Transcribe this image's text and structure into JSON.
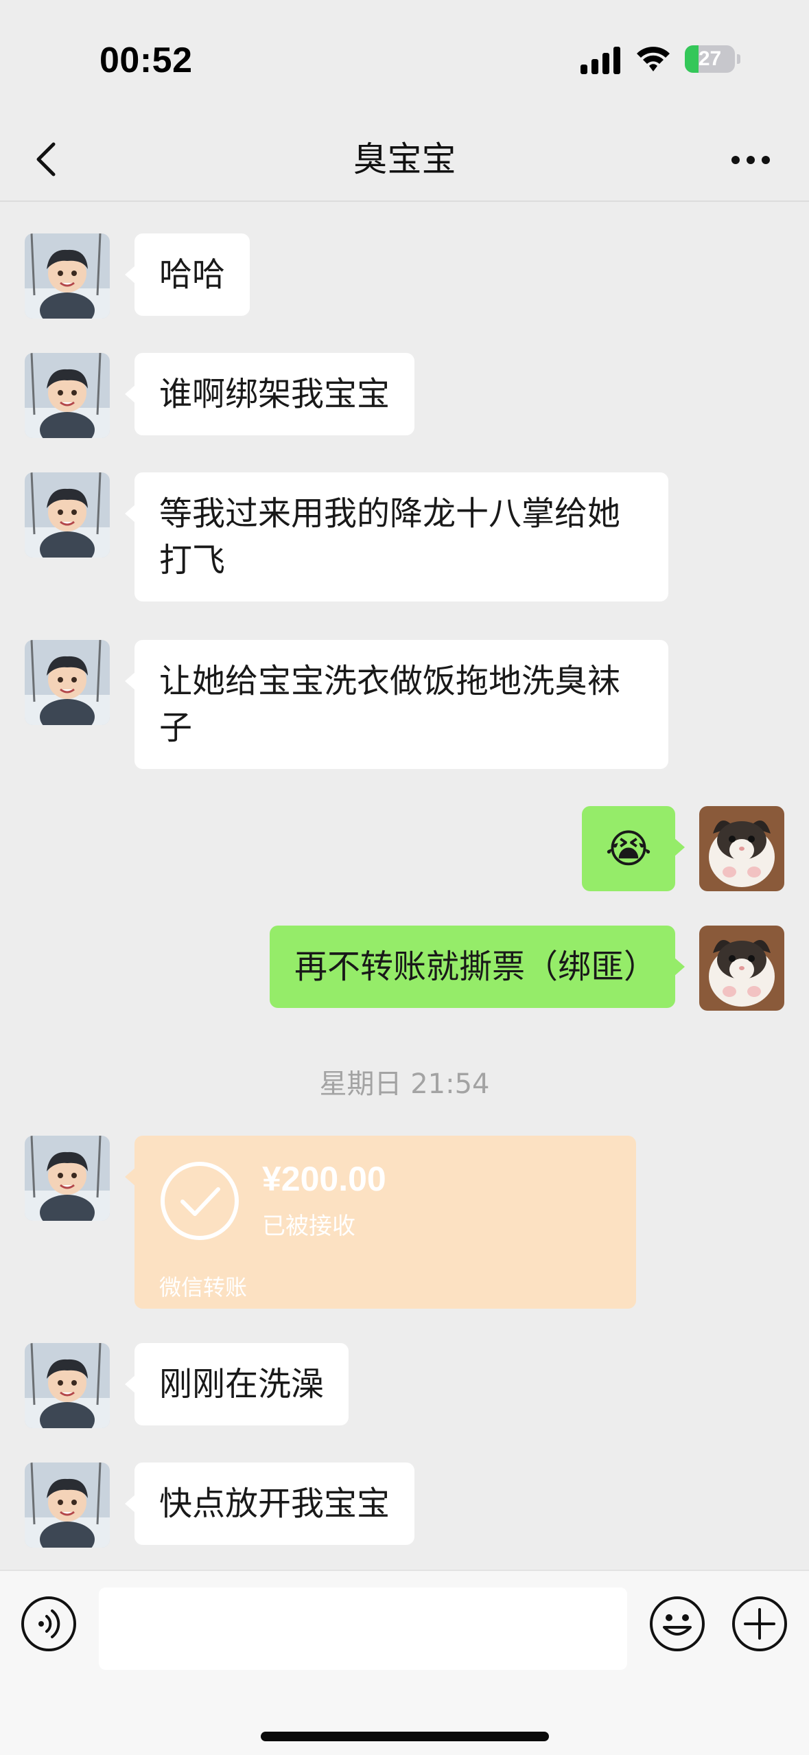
{
  "status_bar": {
    "time": "00:52",
    "battery_level": "27",
    "battery_fraction": 0.27,
    "battery_color": "#34c759",
    "icons": [
      "cellular-signal-icon",
      "wifi-icon",
      "battery-charging-icon"
    ]
  },
  "nav": {
    "title": "臭宝宝",
    "back_icon": "chevron-left-icon",
    "more_icon": "ellipsis-icon"
  },
  "messages": [
    {
      "side": "in",
      "type": "text",
      "text": "哈哈"
    },
    {
      "side": "in",
      "type": "text",
      "text": "谁啊绑架我宝宝"
    },
    {
      "side": "in",
      "type": "text",
      "text": "等我过来用我的降龙十八掌给她打飞"
    },
    {
      "side": "in",
      "type": "text",
      "text": "让她给宝宝洗衣做饭拖地洗臭袜子"
    },
    {
      "side": "out",
      "type": "emoji",
      "text": "😭"
    },
    {
      "side": "out",
      "type": "text",
      "text": "再不转账就撕票（绑匪）"
    },
    {
      "side": "system",
      "type": "timestamp",
      "text": "星期日 21:54"
    },
    {
      "side": "in",
      "type": "transfer",
      "amount": "¥200.00",
      "status": "已被接收",
      "footer": "微信转账"
    },
    {
      "side": "in",
      "type": "text",
      "text": "刚刚在洗澡"
    },
    {
      "side": "in",
      "type": "text",
      "text": "快点放开我宝宝"
    }
  ],
  "avatars": {
    "contact": "anime-boy-in-snow-avatar",
    "self": "kitten-avatar"
  },
  "input_bar": {
    "voice_icon": "voice-input-icon",
    "emoji_icon": "emoji-smile-icon",
    "plus_icon": "plus-circle-icon",
    "placeholder": ""
  },
  "colors": {
    "background": "#ededed",
    "incoming_bubble": "#ffffff",
    "outgoing_bubble": "#95ec69",
    "transfer_card": "#fce1c2"
  }
}
